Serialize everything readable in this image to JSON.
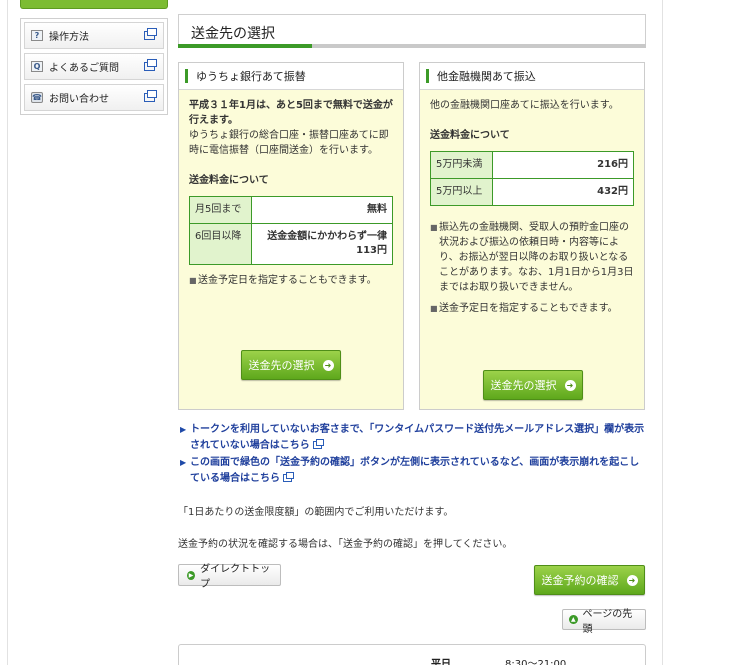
{
  "sidebar": {
    "items": [
      {
        "label": "操作方法",
        "icon": "question-icon"
      },
      {
        "label": "よくあるご質問",
        "icon": "faq-icon"
      },
      {
        "label": "お問い合わせ",
        "icon": "phone-icon"
      }
    ]
  },
  "page": {
    "title": "送金先の選択"
  },
  "yucho_card": {
    "title": "ゆうちょ銀行あて振替",
    "lead_bold": "平成３１年1月は、あと5回まで無料で送金が行えます。",
    "lead_text": "ゆうちょ銀行の総合口座・振替口座あてに即時に電信振替（口座間送金）を行います。",
    "fee_heading": "送金料金について",
    "fees": [
      {
        "key": "月5回まで",
        "value": "無料"
      },
      {
        "key": "6回目以降",
        "value": "送金金額にかかわらず一律113円"
      }
    ],
    "note": "送金予定日を指定することもできます。",
    "button_label": "送金先の選択"
  },
  "other_card": {
    "title": "他金融機関あて振込",
    "lead_text": "他の金融機関口座あてに振込を行います。",
    "fee_heading": "送金料金について",
    "fees": [
      {
        "key": "5万円未満",
        "value": "216円"
      },
      {
        "key": "5万円以上",
        "value": "432円"
      }
    ],
    "notes": [
      "振込先の金融機関、受取人の預貯金口座の状況および振込の依頼日時・内容等により、お振込が翌日以降のお取り扱いとなることがあります。なお、1月1日から1月3日まではお取り扱いできません。",
      "送金予定日を指定することもできます。"
    ],
    "button_label": "送金先の選択"
  },
  "links": [
    "トークンを利用していないお客さまで、「ワンタイムパスワード送付先メールアドレス選択」欄が表示されていない場合はこちら",
    "この画面で緑色の「送金予約の確認」ボタンが左側に表示されているなど、画面が表示崩れを起こしている場合はこちら"
  ],
  "info": {
    "limit_text": "「1日あたりの送金限度額」の範囲内でご利用いただけます。",
    "reserve_text": "送金予約の状況を確認する場合は、「送金予約の確認」を押してください。"
  },
  "buttons": {
    "direct_top": "ダイレクトトップ",
    "reserve_confirm": "送金予約の確認",
    "page_top": "ページの先頭"
  },
  "hours": {
    "label": "平日",
    "value": "8:30～21:00"
  },
  "colors": {
    "accent_green": "#3c9a28",
    "card_bg": "#fcfcd9",
    "link_blue": "#1f3f9c"
  }
}
